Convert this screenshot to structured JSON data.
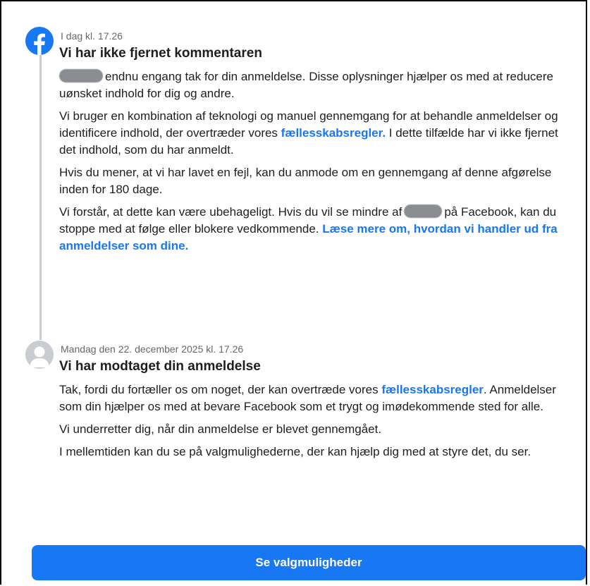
{
  "notifications": [
    {
      "timestamp": "I dag kl. 17.26",
      "title": "Vi har ikke fjernet kommentaren",
      "p1_text": "endnu engang tak for din anmeldelse. Disse oplysninger hjælper os med at reducere uønsket indhold for dig og andre.",
      "p2_before": "Vi bruger en kombination af teknologi og manuel gennemgang for at behandle anmeldelser og identificere indhold, der overtræder vores ",
      "p2_link": "fællesskabsregler.",
      "p2_after": " I dette tilfælde har vi ikke fjernet det indhold, som du har anmeldt.",
      "p3": "Hvis du mener, at vi har lavet en fejl, kan du anmode om en gennemgang af denne afgørelse inden for 180 dage.",
      "p4_before": "Vi forstår, at dette kan være ubehageligt. Hvis du vil se mindre af",
      "p4_after": "på Facebook, kan du stoppe med at følge eller blokere vedkommende. ",
      "p4_link": "Læse mere om, hvordan vi handler ud fra anmeldelser som dine."
    },
    {
      "timestamp": "Mandag den 22. december 2025 kl. 17.26",
      "title": "Vi har modtaget din anmeldelse",
      "p1_before": "Tak, fordi du fortæller os om noget, der kan overtræde vores ",
      "p1_link": "fællesskabsregler",
      "p1_after": ". Anmeldelser som din hjælper os med at bevare Facebook som et trygt og imødekommende sted for alle.",
      "p2": "Vi underretter dig, når din anmeldelse er blevet gennemgået.",
      "p3": "I mellemtiden kan du se på valgmulighederne, der kan hjælp dig med at styre det, du ser."
    }
  ],
  "button_label": "Se valgmuligheder",
  "colors": {
    "brand": "#1877f2",
    "secondary_text": "#65676b",
    "text": "#1c1e21"
  },
  "icons": {
    "first": "facebook-logo-icon",
    "second": "user-avatar-icon"
  }
}
